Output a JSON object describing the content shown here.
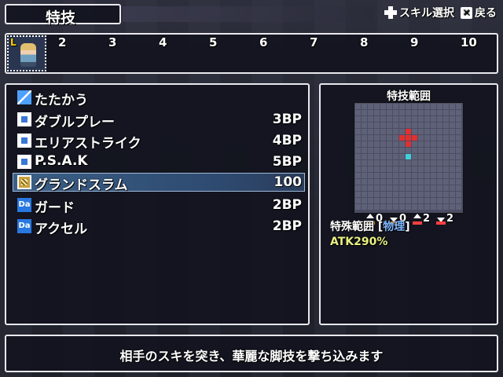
{
  "header": {
    "title": "特技",
    "hint_skill_select": "スキル選択",
    "hint_back": "戻る"
  },
  "party": {
    "slot1_badge": "L",
    "slots": [
      "2",
      "3",
      "4",
      "5",
      "6",
      "7",
      "8",
      "9",
      "10"
    ]
  },
  "skills": [
    {
      "name": "たたかう",
      "cost": "",
      "icon": "sword-icon"
    },
    {
      "name": "ダブルプレー",
      "cost": "3BP",
      "icon": "square-skill-icon"
    },
    {
      "name": "エリアストライク",
      "cost": "4BP",
      "icon": "square-skill-icon"
    },
    {
      "name": "P.S.A.K",
      "cost": "5BP",
      "icon": "square-skill-icon"
    },
    {
      "name": "グランドスラム",
      "cost": "100",
      "icon": "gold-skill-icon",
      "selected": true
    },
    {
      "name": "ガード",
      "cost": "2BP",
      "icon": "da-icon"
    },
    {
      "name": "アクセル",
      "cost": "2BP",
      "icon": "da-icon"
    }
  ],
  "range_panel": {
    "title": "特技範囲",
    "stats": [
      {
        "dir": "up",
        "color": "#ffb000",
        "value": "0"
      },
      {
        "dir": "down",
        "color": "#ffb000",
        "value": "0"
      },
      {
        "dir": "up",
        "color": "#ff4040",
        "value": "2"
      },
      {
        "dir": "down",
        "color": "#ff4040",
        "value": "2"
      }
    ],
    "range_type_label": "特殊範囲 [",
    "range_type_value": "物理",
    "range_type_close": "]",
    "atk": "ATK290%"
  },
  "description": "相手のスキを突き、華麗な脚技を撃ち込みます",
  "colors": {
    "accent": "#3978d6",
    "target": "#e03030",
    "origin": "#40d0d8"
  }
}
